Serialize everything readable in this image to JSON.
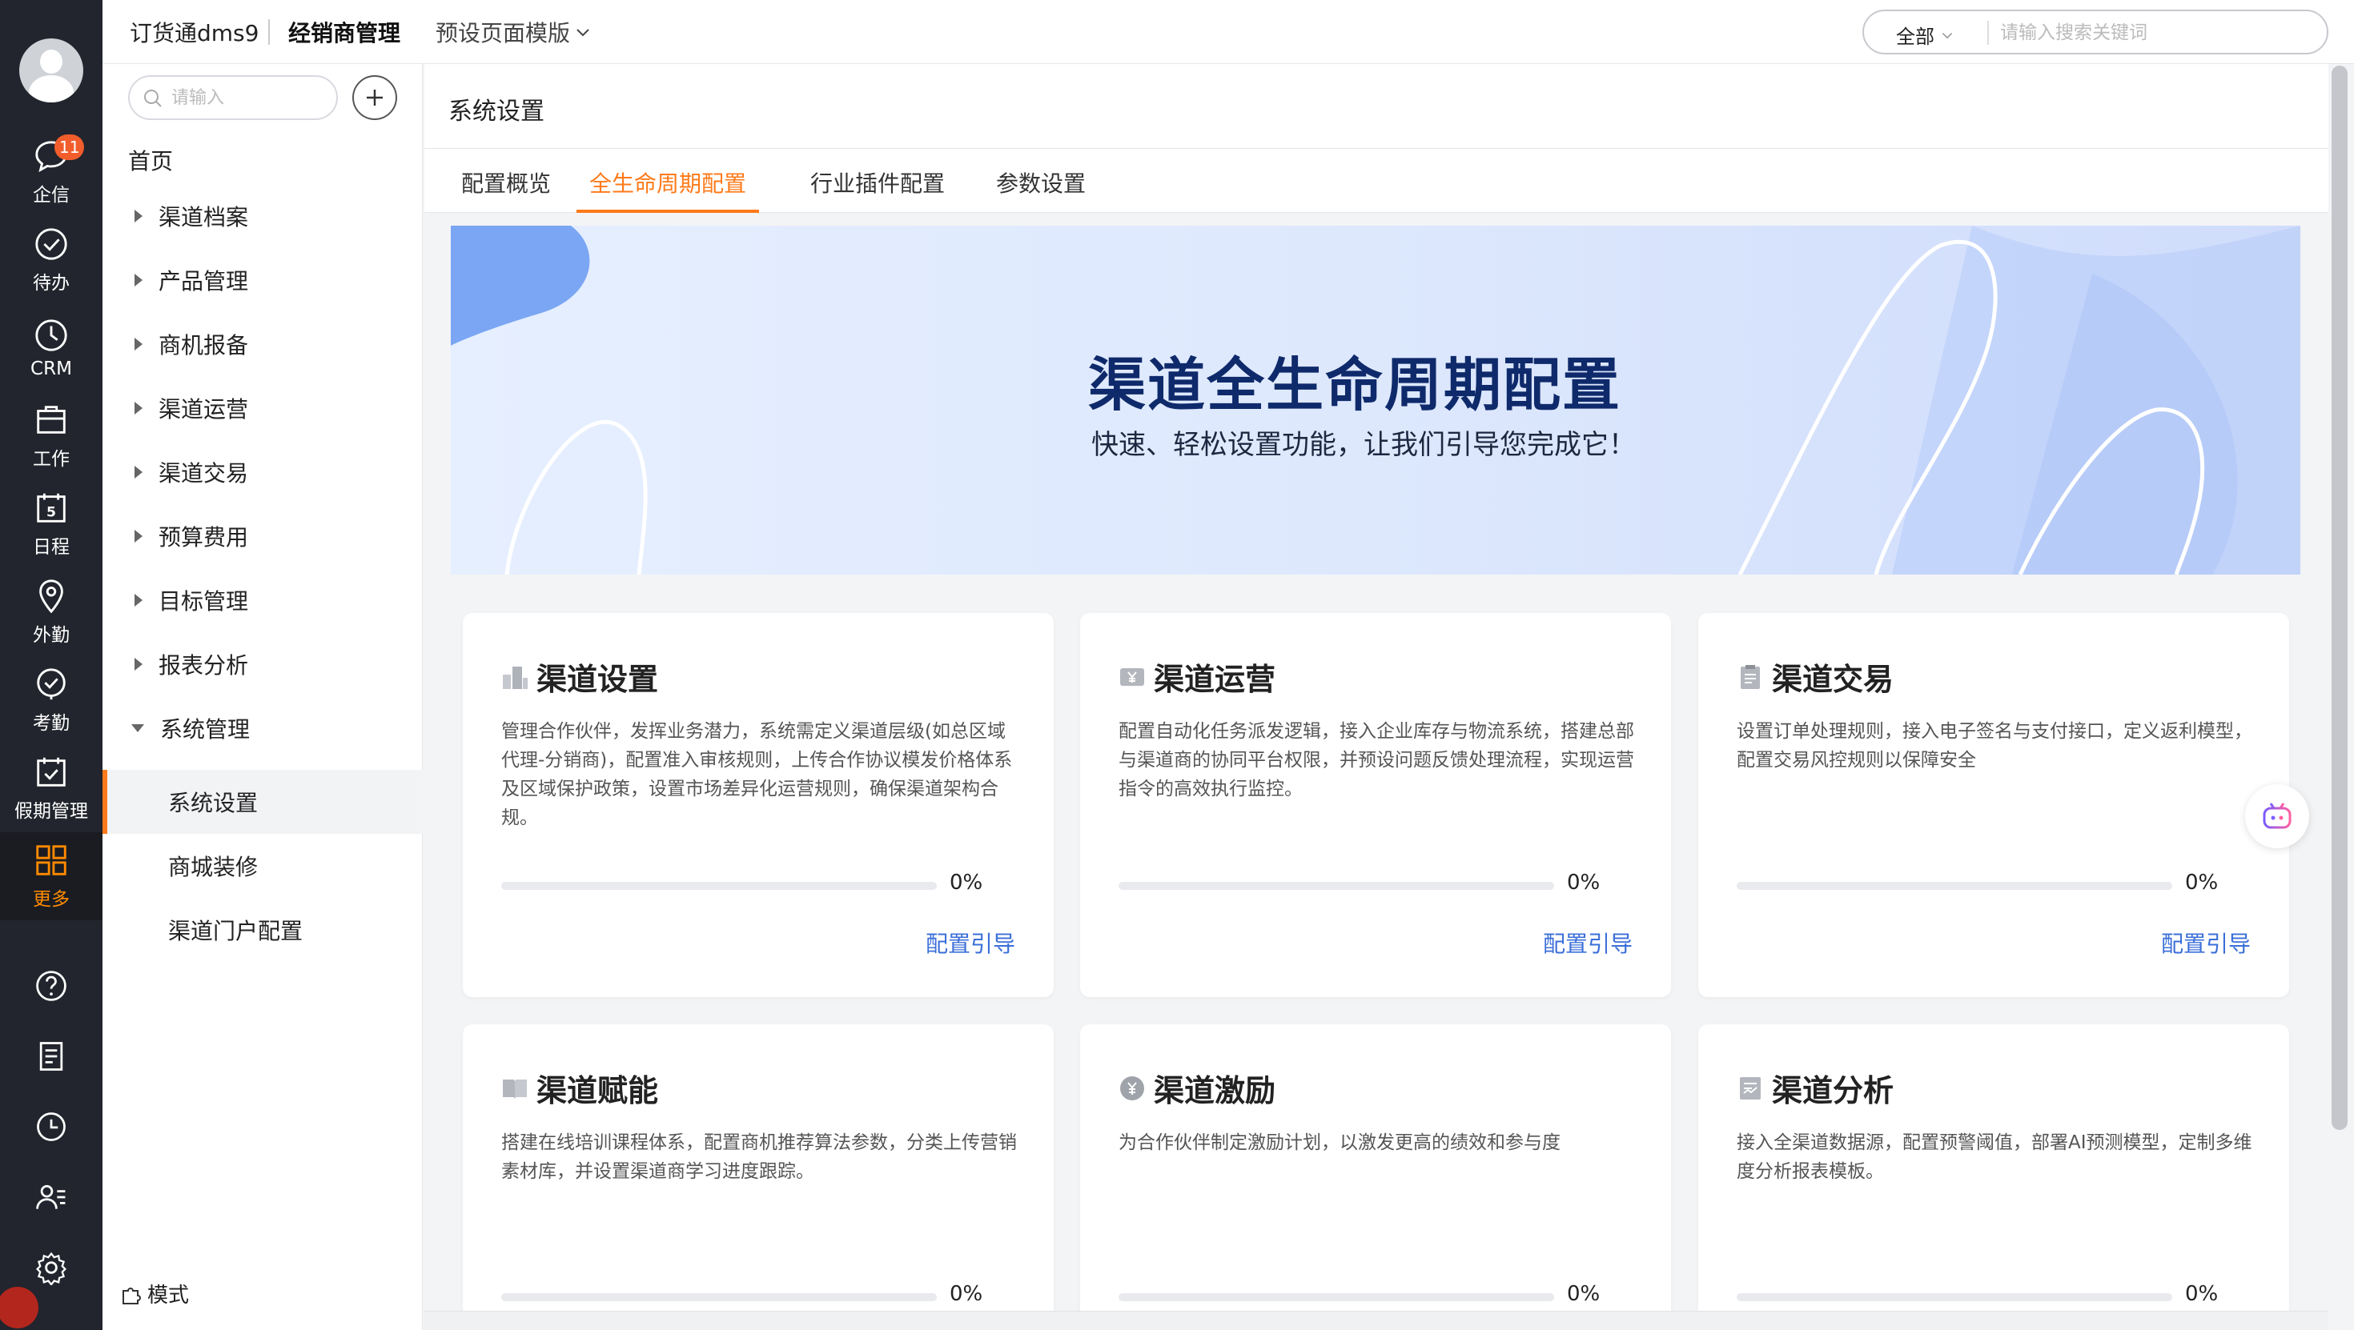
{
  "rail": {
    "items": [
      {
        "label": "企信",
        "icon": "chat-icon",
        "badge": "11"
      },
      {
        "label": "待办",
        "icon": "check-circle-icon"
      },
      {
        "label": "CRM",
        "icon": "clock-icon"
      },
      {
        "label": "工作",
        "icon": "briefcase-icon"
      },
      {
        "label": "日程",
        "icon": "calendar-icon",
        "day": "5"
      },
      {
        "label": "外勤",
        "icon": "location-icon"
      },
      {
        "label": "考勤",
        "icon": "shield-check-icon"
      },
      {
        "label": "假期管理",
        "icon": "calendar-check-icon"
      },
      {
        "label": "更多",
        "icon": "grid-icon"
      }
    ],
    "bottom_icons": [
      "help-icon",
      "document-icon",
      "history-icon",
      "user-list-icon",
      "gear-icon"
    ]
  },
  "topbar": {
    "app_name": "订货通dms9",
    "module": "经销商管理",
    "template": "预设页面模版",
    "search_scope": "全部",
    "search_placeholder": "请输入搜索关键词"
  },
  "leftnav": {
    "search_placeholder": "请输入",
    "home": "首页",
    "items": [
      "渠道档案",
      "产品管理",
      "商机报备",
      "渠道运营",
      "渠道交易",
      "预算费用",
      "目标管理",
      "报表分析",
      "系统管理"
    ],
    "subitems": [
      "系统设置",
      "商城装修",
      "渠道门户配置"
    ],
    "active_sub": "系统设置",
    "mode": "模式"
  },
  "page": {
    "title": "系统设置",
    "tabs": [
      "配置概览",
      "全生命周期配置",
      "行业插件配置",
      "参数设置"
    ],
    "active_tab": "全生命周期配置"
  },
  "banner": {
    "title": "渠道全生命周期配置",
    "subtitle": "快速、轻松设置功能，让我们引导您完成它！"
  },
  "cards": [
    {
      "title": "渠道设置",
      "icon": "building-icon",
      "desc": "管理合作伙伴，发挥业务潜力，系统需定义渠道层级(如总区域代理-分销商)，配置准入审核规则，上传合作协议模发价格体系及区域保护政策，设置市场差异化运营规则，确保渠道架构合规。",
      "progress": 0,
      "progress_label": "0%",
      "link": "配置引导"
    },
    {
      "title": "渠道运营",
      "icon": "yen-card-icon",
      "desc": "配置自动化任务派发逻辑，接入企业库存与物流系统，搭建总部与渠道商的协同平台权限，并预设问题反馈处理流程，实现运营指令的高效执行监控。",
      "progress": 0,
      "progress_label": "0%",
      "link": "配置引导"
    },
    {
      "title": "渠道交易",
      "icon": "clipboard-icon",
      "desc": "设置订单处理规则，接入电子签名与支付接口，定义返利模型，配置交易风控规则以保障安全",
      "progress": 0,
      "progress_label": "0%",
      "link": "配置引导"
    },
    {
      "title": "渠道赋能",
      "icon": "book-icon",
      "desc": "搭建在线培训课程体系，配置商机推荐算法参数，分类上传营销素材库，并设置渠道商学习进度跟踪。",
      "progress": 0,
      "progress_label": "0%",
      "link": ""
    },
    {
      "title": "渠道激励",
      "icon": "coin-icon",
      "desc": "为合作伙伴制定激励计划，以激发更高的绩效和参与度",
      "progress": 0,
      "progress_label": "0%",
      "link": ""
    },
    {
      "title": "渠道分析",
      "icon": "report-icon",
      "desc": "接入全渠道数据源，配置预警阈值，部署AI预测模型，定制多维度分析报表模板。",
      "progress": 0,
      "progress_label": "0%",
      "link": ""
    }
  ],
  "colors": {
    "accent": "#ff7a1a",
    "link": "#3b6fd8",
    "rail": "#22252d",
    "badge": "#f25d2c"
  }
}
